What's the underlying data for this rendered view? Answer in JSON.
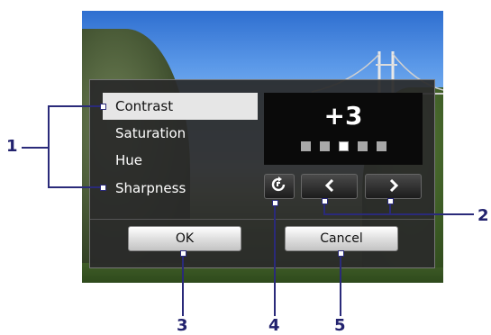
{
  "menu": {
    "items": [
      {
        "label": "Contrast",
        "selected": true
      },
      {
        "label": "Saturation",
        "selected": false
      },
      {
        "label": "Hue",
        "selected": false
      },
      {
        "label": "Sharpness",
        "selected": false
      }
    ]
  },
  "value_panel": {
    "value": "+3",
    "level": 3,
    "levels": 5
  },
  "controls": {
    "reset_icon": "reset-icon",
    "prev_icon": "chevron-left-icon",
    "next_icon": "chevron-right-icon"
  },
  "buttons": {
    "ok": "OK",
    "cancel": "Cancel"
  },
  "callouts": {
    "c1": "1",
    "c2": "2",
    "c3": "3",
    "c4": "4",
    "c5": "5"
  },
  "colors": {
    "callout": "#22226e",
    "selected_bg": "#e6e6e6",
    "panel_bg": "#0a0a0a"
  }
}
